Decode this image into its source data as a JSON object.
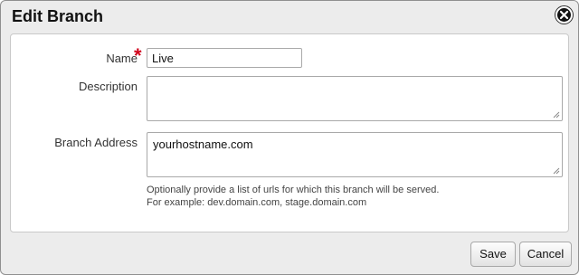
{
  "dialog": {
    "title": "Edit Branch",
    "close_icon": "close-icon"
  },
  "form": {
    "name": {
      "label": "Name",
      "required_marker": "*",
      "value": "Live"
    },
    "description": {
      "label": "Description",
      "value": ""
    },
    "branch_address": {
      "label": "Branch Address",
      "value": "yourhostname.com",
      "help_line1": "Optionally provide a list of urls for which this branch will be served.",
      "help_line2": "For example: dev.domain.com, stage.domain.com"
    }
  },
  "footer": {
    "save_label": "Save",
    "cancel_label": "Cancel"
  },
  "colors": {
    "required": "#d0021b",
    "panel_background": "#ececec"
  }
}
